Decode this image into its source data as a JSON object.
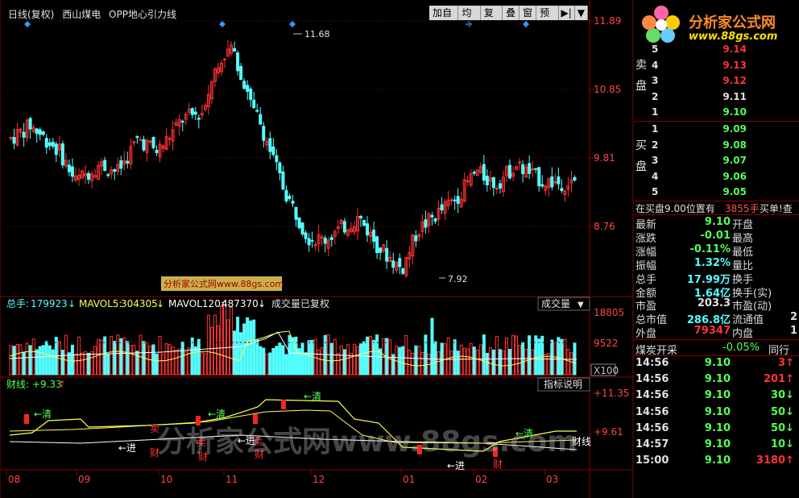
{
  "header": {
    "period": "日线(复权)",
    "stock_name": "西山煤电",
    "indicator": "OPP地心引力线",
    "toolbar": [
      "加自选",
      "均线",
      "复权",
      "叠",
      "窗",
      "预测",
      "▶|",
      "▼"
    ]
  },
  "price_axis": [
    "11.89",
    "10.85",
    "9.81",
    "8.76"
  ],
  "annotations": {
    "high": "11.68",
    "low": "7.92"
  },
  "watermark_small": "分析家公式网www.88gs.com",
  "volume_panel": {
    "label_total": "总手:",
    "total": "179923",
    "label_ma5": "MAVOL5:",
    "ma5": "304305",
    "label_ma120": "MAVOL120:",
    "ma120": "487370",
    "note": "成交量已复权",
    "dropdown": "成交量",
    "axis": [
      "18805",
      "9522",
      "X100"
    ]
  },
  "indicator_panel": {
    "label": "财线:",
    "value": "+9.33",
    "explain": "指标说明",
    "axis": [
      "+11.35",
      "+9.61"
    ],
    "signals": [
      "←清",
      "←清",
      "←清",
      "←清",
      "←进",
      "←进",
      "←进",
      "卖",
      "卖",
      "卖",
      "财",
      "财",
      "财",
      "财",
      "财线"
    ]
  },
  "x_axis": [
    "08",
    "09",
    "10",
    "11",
    "12",
    "01",
    "02",
    "03"
  ],
  "watermark_big": "分析家公式网www.88gs.com",
  "logo": {
    "text": "分析家公式网",
    "url": "www.88gs.com"
  },
  "orderbook": {
    "sell_label": [
      "卖",
      "盘"
    ],
    "buy_label": [
      "买",
      "盘"
    ],
    "sell": [
      {
        "level": "5",
        "price": "9.14"
      },
      {
        "level": "4",
        "price": "9.13"
      },
      {
        "level": "3",
        "price": "9.12"
      },
      {
        "level": "2",
        "price": "9.11"
      },
      {
        "level": "1",
        "price": "9.10"
      }
    ],
    "buy": [
      {
        "level": "1",
        "price": "9.09"
      },
      {
        "level": "2",
        "price": "9.08"
      },
      {
        "level": "3",
        "price": "9.07"
      },
      {
        "level": "4",
        "price": "9.06"
      },
      {
        "level": "5",
        "price": "9.05"
      }
    ]
  },
  "buy_info": {
    "left": "在买盘9.00位置有",
    "mid": "3855手",
    "right": "买单!查"
  },
  "stats": [
    {
      "l1": "最新",
      "v1": "9.10",
      "l2": "开盘",
      "v2": ""
    },
    {
      "l1": "涨跌",
      "v1": "-0.01",
      "l2": "最高",
      "v2": ""
    },
    {
      "l1": "涨幅",
      "v1": "-0.11%",
      "l2": "最低",
      "v2": ""
    },
    {
      "l1": "振幅",
      "v1": "1.32%",
      "l2": "量比",
      "v2": ""
    },
    {
      "l1": "总手",
      "v1": "17.99万",
      "l2": "换手",
      "v2": ""
    },
    {
      "l1": "金额",
      "v1": "1.64亿",
      "l2": "换手(实)",
      "v2": ""
    },
    {
      "l1": "市盈",
      "v1": "203.3",
      "l2": "市盈(动)",
      "v2": ""
    },
    {
      "l1": "总市值",
      "v1": "286.8亿",
      "l2": "流通值",
      "v2": "2"
    },
    {
      "l1": "外盘",
      "v1": "79347",
      "l2": "内盘",
      "v2": "1"
    }
  ],
  "sector": {
    "name": "煤炭开采",
    "change": "-0.05%",
    "peer": "同行"
  },
  "ticks": [
    {
      "time": "14:56",
      "price": "9.10",
      "vol": "3",
      "dir": "up"
    },
    {
      "time": "14:56",
      "price": "9.10",
      "vol": "201",
      "dir": "up"
    },
    {
      "time": "14:56",
      "price": "9.10",
      "vol": "30",
      "dir": "down"
    },
    {
      "time": "14:56",
      "price": "9.10",
      "vol": "50",
      "dir": "down"
    },
    {
      "time": "14:56",
      "price": "9.10",
      "vol": "50",
      "dir": "down"
    },
    {
      "time": "14:57",
      "price": "9.10",
      "vol": "10",
      "dir": "down"
    },
    {
      "time": "15:00",
      "price": "9.10",
      "vol": "3180",
      "dir": "up"
    }
  ],
  "colors": {
    "up": "#ff3333",
    "down": "#55ffff",
    "green": "#55ff55",
    "yellow": "#ffff55",
    "grid": "#8b0000"
  }
}
